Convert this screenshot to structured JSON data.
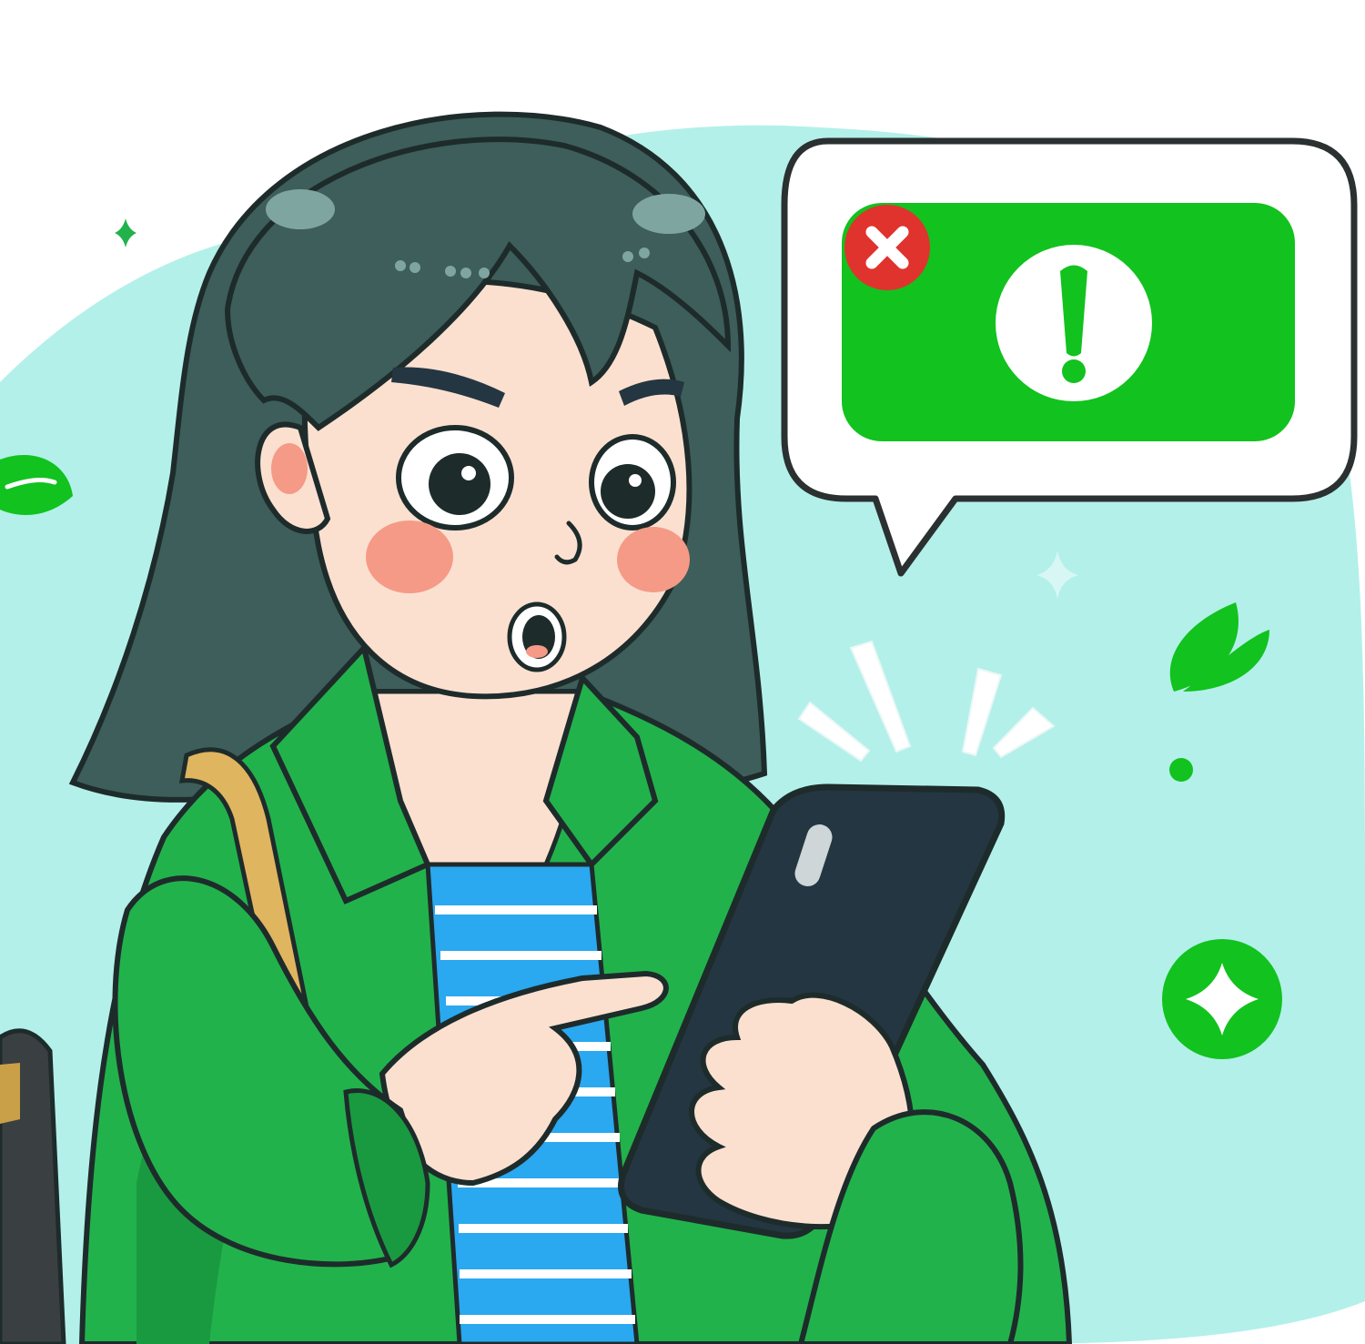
{
  "scene": {
    "subject": "woman-looking-at-phone",
    "colors": {
      "backdrop": "#b3f0ea",
      "jacket": "#22b24c",
      "jacket_shadow": "#1a9a40",
      "hair": "#3d5e5a",
      "skin": "#fbe0d0",
      "cheek": "#f59a86",
      "shirt_blue": "#2aa8f0",
      "strap": "#e0b560",
      "phone": "#243641",
      "bubble": "#ffffff",
      "alert_green": "#12c21e",
      "close_red": "#e0332e",
      "outline": "#1e2b2b"
    },
    "icons": [
      "speech-bubble-icon",
      "warning-alert-icon",
      "close-icon",
      "sparkle-icon",
      "leaf-icon"
    ]
  }
}
